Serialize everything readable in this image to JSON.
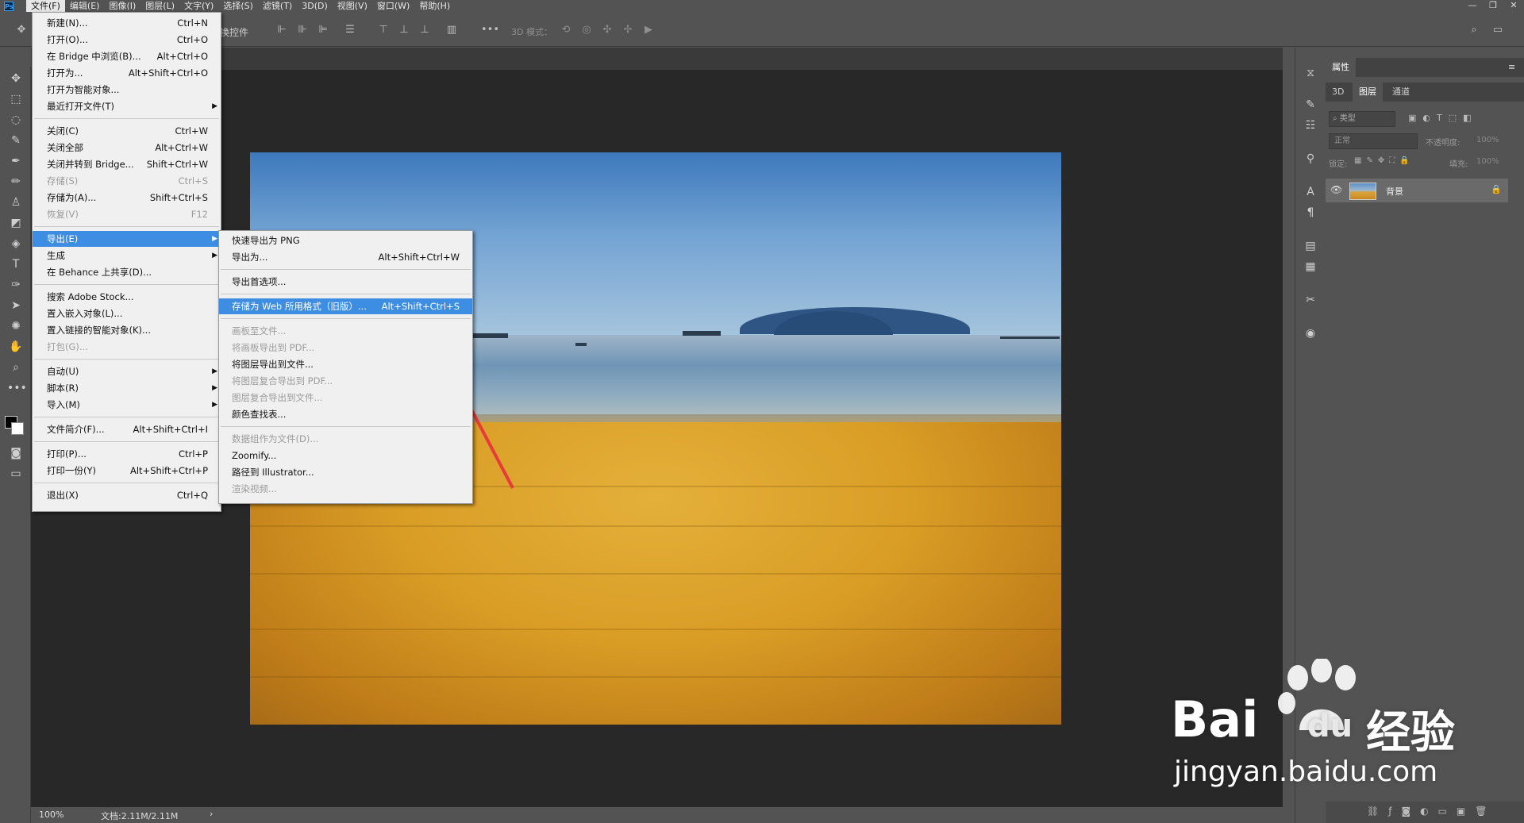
{
  "menubar": {
    "items": [
      "文件(F)",
      "编辑(E)",
      "图像(I)",
      "图层(L)",
      "文字(Y)",
      "选择(S)",
      "滤镜(T)",
      "3D(D)",
      "视图(V)",
      "窗口(W)",
      "帮助(H)"
    ],
    "app_logo": "Ps"
  },
  "options": {
    "transform_label": "换控件",
    "mode3d_label": "3D 模式："
  },
  "file_menu": {
    "items": [
      {
        "label": "新建(N)...",
        "shortcut": "Ctrl+N"
      },
      {
        "label": "打开(O)...",
        "shortcut": "Ctrl+O"
      },
      {
        "label": "在 Bridge 中浏览(B)...",
        "shortcut": "Alt+Ctrl+O"
      },
      {
        "label": "打开为...",
        "shortcut": "Alt+Shift+Ctrl+O"
      },
      {
        "label": "打开为智能对象...",
        "shortcut": ""
      },
      {
        "label": "最近打开文件(T)",
        "shortcut": ""
      },
      {
        "label": "关闭(C)",
        "shortcut": "Ctrl+W"
      },
      {
        "label": "关闭全部",
        "shortcut": "Alt+Ctrl+W"
      },
      {
        "label": "关闭并转到 Bridge...",
        "shortcut": "Shift+Ctrl+W"
      },
      {
        "label": "存储(S)",
        "shortcut": "Ctrl+S"
      },
      {
        "label": "存储为(A)...",
        "shortcut": "Shift+Ctrl+S"
      },
      {
        "label": "恢复(V)",
        "shortcut": "F12"
      },
      {
        "label": "导出(E)",
        "shortcut": ""
      },
      {
        "label": "生成",
        "shortcut": ""
      },
      {
        "label": "在 Behance 上共享(D)...",
        "shortcut": ""
      },
      {
        "label": "搜索 Adobe Stock...",
        "shortcut": ""
      },
      {
        "label": "置入嵌入对象(L)...",
        "shortcut": ""
      },
      {
        "label": "置入链接的智能对象(K)...",
        "shortcut": ""
      },
      {
        "label": "打包(G)...",
        "shortcut": ""
      },
      {
        "label": "自动(U)",
        "shortcut": ""
      },
      {
        "label": "脚本(R)",
        "shortcut": ""
      },
      {
        "label": "导入(M)",
        "shortcut": ""
      },
      {
        "label": "文件简介(F)...",
        "shortcut": "Alt+Shift+Ctrl+I"
      },
      {
        "label": "打印(P)...",
        "shortcut": "Ctrl+P"
      },
      {
        "label": "打印一份(Y)",
        "shortcut": "Alt+Shift+Ctrl+P"
      },
      {
        "label": "退出(X)",
        "shortcut": "Ctrl+Q"
      }
    ]
  },
  "export_menu": {
    "items": [
      {
        "label": "快速导出为 PNG",
        "shortcut": ""
      },
      {
        "label": "导出为...",
        "shortcut": "Alt+Shift+Ctrl+W"
      },
      {
        "label": "导出首选项...",
        "shortcut": ""
      },
      {
        "label": "存储为 Web 所用格式（旧版）...",
        "shortcut": "Alt+Shift+Ctrl+S"
      },
      {
        "label": "画板至文件...",
        "shortcut": ""
      },
      {
        "label": "将画板导出到 PDF...",
        "shortcut": ""
      },
      {
        "label": "将图层导出到文件...",
        "shortcut": ""
      },
      {
        "label": "将图层复合导出到 PDF...",
        "shortcut": ""
      },
      {
        "label": "图层复合导出到文件...",
        "shortcut": ""
      },
      {
        "label": "颜色查找表...",
        "shortcut": ""
      },
      {
        "label": "数据组作为文件(D)...",
        "shortcut": ""
      },
      {
        "label": "Zoomify...",
        "shortcut": ""
      },
      {
        "label": "路径到 Illustrator...",
        "shortcut": ""
      },
      {
        "label": "渲染视频...",
        "shortcut": ""
      }
    ]
  },
  "status": {
    "zoom": "100%",
    "doc": "文档:2.11M/2.11M",
    "arrow": "›"
  },
  "panel": {
    "header": "属性",
    "tabs": [
      "3D",
      "图层",
      "通道"
    ],
    "filter_placeholder": "类型",
    "blend_mode": "正常",
    "opacity_label": "不透明度:",
    "opacity_value": "100%",
    "lock_label": "锁定:",
    "fill_label": "填充:",
    "fill_value": "100%",
    "layer_name": "背景"
  },
  "watermark": {
    "logo_text": "Bai",
    "logo_text2": "du",
    "cn_text": "经验",
    "url": "jingyan.baidu.com"
  },
  "accent_color": "#3d8ee2",
  "annotation_color": "#e8393b"
}
